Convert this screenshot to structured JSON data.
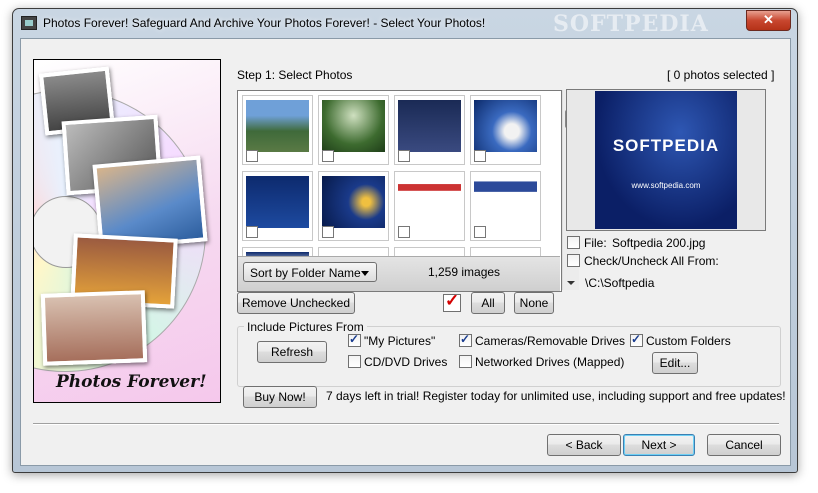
{
  "window": {
    "title": "Photos Forever!  Safeguard And Archive Your Photos Forever! - Select Your Photos!",
    "watermark": "SOFTPEDIA",
    "close_glyph": "✕"
  },
  "banner": {
    "text": "Photos Forever!"
  },
  "step": {
    "label": "Step 1:  Select Photos",
    "selected_count": "[ 0 photos selected ]"
  },
  "thumbnails": {
    "sort_option": "Sort by Folder Name",
    "image_count": "1,259 images"
  },
  "preview": {
    "logo_text": "SOFTPEDIA",
    "url_text": "www.softpedia.com",
    "file_label": "File:",
    "file_name": "Softpedia 200.jpg",
    "check_all_label": "Check/Uncheck All From:",
    "folder_path": "\\C:\\Softpedia"
  },
  "actions": {
    "remove_unchecked": "Remove Unchecked",
    "all": "All",
    "none": "None"
  },
  "include": {
    "legend": "Include Pictures From",
    "refresh": "Refresh",
    "my_pictures": "\"My Pictures\"",
    "cameras": "Cameras/Removable Drives",
    "custom_folders": "Custom Folders",
    "cd_dvd": "CD/DVD Drives",
    "network": "Networked Drives (Mapped)",
    "edit": "Edit..."
  },
  "trial": {
    "buy_now": "Buy Now!",
    "message": "7 days left in trial!  Register today for unlimited use, including support and free updates!"
  },
  "nav": {
    "back": "< Back",
    "next": "Next >",
    "cancel": "Cancel"
  },
  "colors": {
    "title_gradient_top": "#c9d6e3",
    "close_red": "#c8472f",
    "check_red": "#d40000",
    "dialog_bg": "#f0f0f0"
  }
}
